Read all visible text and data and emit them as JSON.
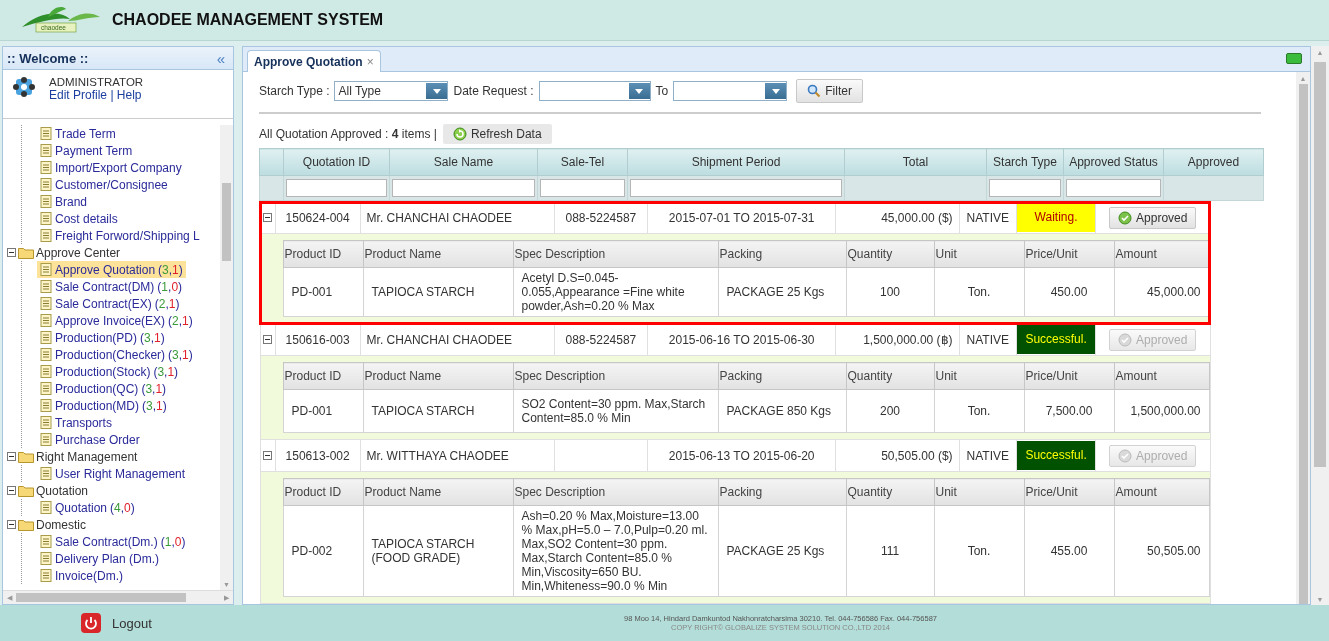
{
  "header": {
    "logo_text": "chaodee",
    "title": "CHAODEE MANAGEMENT SYSTEM"
  },
  "sidebar": {
    "title": ":: Welcome ::",
    "collapse": "«",
    "user": {
      "name": "ADMINISTRATOR",
      "links": [
        "Edit Profile",
        "Help"
      ],
      "separator": "|"
    },
    "tree": [
      {
        "expanded": true,
        "children": [
          {
            "label": "Trade Term",
            "selected": false
          },
          {
            "label": "Payment Term",
            "selected": false
          },
          {
            "label": "Import/Export Company",
            "selected": false
          },
          {
            "label": "Customer/Consignee",
            "selected": false
          },
          {
            "label": "Brand",
            "selected": false
          },
          {
            "label": "Cost details",
            "selected": false
          },
          {
            "label": "Freight Forword/Shipping L",
            "selected": false
          }
        ]
      },
      {
        "label": "Approve Center",
        "expanded": true,
        "children": [
          {
            "label": "Approve Quotation",
            "selected": true,
            "count": [
              {
                "text": "(",
                "kind": "plain"
              },
              {
                "text": "3",
                "kind": "first"
              },
              {
                "text": ",",
                "kind": "plain"
              },
              {
                "text": "1",
                "kind": "second"
              },
              {
                "text": ")",
                "kind": "plain"
              }
            ]
          },
          {
            "label": "Sale Contract(DM)",
            "selected": false,
            "count": [
              {
                "text": "(",
                "kind": "plain"
              },
              {
                "text": "1",
                "kind": "first"
              },
              {
                "text": ",",
                "kind": "plain"
              },
              {
                "text": "0",
                "kind": "second"
              },
              {
                "text": ")",
                "kind": "plain"
              }
            ]
          },
          {
            "label": "Sale Contract(EX)",
            "selected": false,
            "count": [
              {
                "text": "(",
                "kind": "plain"
              },
              {
                "text": "2",
                "kind": "first"
              },
              {
                "text": ",",
                "kind": "plain"
              },
              {
                "text": "1",
                "kind": "second"
              },
              {
                "text": ")",
                "kind": "plain"
              }
            ]
          },
          {
            "label": "Approve Invoice(EX)",
            "selected": false,
            "count": [
              {
                "text": "(",
                "kind": "plain"
              },
              {
                "text": "2",
                "kind": "first"
              },
              {
                "text": ",",
                "kind": "plain"
              },
              {
                "text": "1",
                "kind": "second"
              },
              {
                "text": ")",
                "kind": "plain"
              }
            ]
          },
          {
            "label": "Production(PD)",
            "selected": false,
            "count": [
              {
                "text": "(",
                "kind": "plain"
              },
              {
                "text": "3",
                "kind": "first"
              },
              {
                "text": ",",
                "kind": "plain"
              },
              {
                "text": "1",
                "kind": "second"
              },
              {
                "text": ")",
                "kind": "plain"
              }
            ]
          },
          {
            "label": "Production(Checker)",
            "selected": false,
            "count": [
              {
                "text": "(",
                "kind": "plain"
              },
              {
                "text": "3",
                "kind": "first"
              },
              {
                "text": ",",
                "kind": "plain"
              },
              {
                "text": "1",
                "kind": "second"
              },
              {
                "text": ")",
                "kind": "plain"
              }
            ]
          },
          {
            "label": "Production(Stock)",
            "selected": false,
            "count": [
              {
                "text": "(",
                "kind": "plain"
              },
              {
                "text": "3",
                "kind": "first"
              },
              {
                "text": ",",
                "kind": "plain"
              },
              {
                "text": "1",
                "kind": "second"
              },
              {
                "text": ")",
                "kind": "plain"
              }
            ]
          },
          {
            "label": "Production(QC)",
            "selected": false,
            "count": [
              {
                "text": "(",
                "kind": "plain"
              },
              {
                "text": "3",
                "kind": "first"
              },
              {
                "text": ",",
                "kind": "plain"
              },
              {
                "text": "1",
                "kind": "second"
              },
              {
                "text": ")",
                "kind": "plain"
              }
            ]
          },
          {
            "label": "Production(MD)",
            "selected": false,
            "count": [
              {
                "text": "(",
                "kind": "plain"
              },
              {
                "text": "3",
                "kind": "first"
              },
              {
                "text": ",",
                "kind": "plain"
              },
              {
                "text": "1",
                "kind": "second"
              },
              {
                "text": ")",
                "kind": "plain"
              }
            ]
          },
          {
            "label": "Transports",
            "selected": false
          },
          {
            "label": "Purchase Order",
            "selected": false
          }
        ]
      },
      {
        "label": "Right Management",
        "expanded": true,
        "children": [
          {
            "label": "User Right Management",
            "selected": false
          }
        ]
      },
      {
        "label": "Quotation",
        "expanded": true,
        "children": [
          {
            "label": "Quotation",
            "selected": false,
            "count": [
              {
                "text": "(",
                "kind": "plain"
              },
              {
                "text": "4",
                "kind": "first"
              },
              {
                "text": ",",
                "kind": "plain"
              },
              {
                "text": "0",
                "kind": "second"
              },
              {
                "text": ")",
                "kind": "plain"
              }
            ]
          }
        ]
      },
      {
        "label": "Domestic",
        "expanded": true,
        "children": [
          {
            "label": "Sale Contract(Dm.)",
            "selected": false,
            "count": [
              {
                "text": "(",
                "kind": "plain"
              },
              {
                "text": "1",
                "kind": "first"
              },
              {
                "text": ",",
                "kind": "plain"
              },
              {
                "text": "0",
                "kind": "second"
              },
              {
                "text": ")",
                "kind": "plain"
              }
            ]
          },
          {
            "label": "Delivery Plan (Dm.)",
            "selected": false
          },
          {
            "label": "Invoice(Dm.)",
            "selected": false
          }
        ]
      }
    ],
    "logout": "Logout"
  },
  "scroll_arrows": {
    "up": "▲",
    "down": "▼",
    "left": "◀",
    "right": "▶"
  },
  "tabs": [
    {
      "label": "Approve Quotation",
      "close": "×",
      "selected": true
    }
  ],
  "filters": {
    "starch_type": {
      "label": "Starch Type :",
      "value": "All Type"
    },
    "date_request": {
      "label": "Date Request :"
    },
    "to": {
      "label": "To"
    },
    "filter_button": "Filter"
  },
  "summary": {
    "text": "All Quotation Approved : **4** items |",
    "refresh_button": "Refresh Data"
  },
  "table": {
    "columns": [
      {
        "label": "Quotation ID",
        "filter": true
      },
      {
        "label": "Sale Name",
        "filter": true
      },
      {
        "label": "Sale-Tel",
        "filter": true
      },
      {
        "label": "Shipment Period",
        "filter": true
      },
      {
        "label": "Total",
        "filter": false
      },
      {
        "label": "Starch Type",
        "filter": true
      },
      {
        "label": "Approved Status",
        "filter": true
      },
      {
        "label": "Approved",
        "filter": false
      }
    ],
    "rows": [
      {
        "expanded": true,
        "highlighted": true,
        "quotation_id": "150624-004",
        "sale_name": "Mr. CHANCHAI CHAODEE",
        "sale_tel": "088-5224587",
        "shipment_period": "2015-07-01 TO 2015-07-31",
        "total": "45,000.00 ($)",
        "starch_type": "NATIVE",
        "status": {
          "text": "Waiting.",
          "kind": "waiting"
        },
        "approve_button": {
          "label": "Approved",
          "disabled": false
        },
        "detail_columns": [
          "Product ID",
          "Product Name",
          "Spec Description",
          "Packing",
          "Quantity",
          "Unit",
          "Price/Unit",
          "Amount"
        ],
        "details": [
          [
            "PD-001",
            "TAPIOCA STARCH",
            "Acetyl D.S=0.045-0.055,Appearance =Fine white powder,Ash=0.20 % Max",
            "PACKAGE 25 Kgs",
            "100",
            "Ton.",
            "450.00",
            "45,000.00"
          ]
        ]
      },
      {
        "expanded": true,
        "highlighted": false,
        "quotation_id": "150616-003",
        "sale_name": "Mr. CHANCHAI CHAODEE",
        "sale_tel": "088-5224587",
        "shipment_period": "2015-06-16 TO 2015-06-30",
        "total": "1,500,000.00 (฿)",
        "starch_type": "NATIVE",
        "status": {
          "text": "Successful.",
          "kind": "successful"
        },
        "approve_button": {
          "label": "Approved",
          "disabled": true
        },
        "detail_columns": [
          "Product ID",
          "Product Name",
          "Spec Description",
          "Packing",
          "Quantity",
          "Unit",
          "Price/Unit",
          "Amount"
        ],
        "details": [
          [
            "PD-001",
            "TAPIOCA STARCH",
            "SO2 Content=30 ppm. Max,Starch Content=85.0 % Min",
            "PACKAGE 850 Kgs",
            "200",
            "Ton.",
            "7,500.00",
            "1,500,000.00"
          ]
        ]
      },
      {
        "expanded": true,
        "highlighted": false,
        "quotation_id": "150613-002",
        "sale_name": "Mr. WITTHAYA CHAODEE",
        "shipment_period": "2015-06-13 TO 2015-06-20",
        "total": "50,505.00 ($)",
        "starch_type": "NATIVE",
        "status": {
          "text": "Successful.",
          "kind": "successful"
        },
        "approve_button": {
          "label": "Approved",
          "disabled": true
        },
        "detail_columns": [
          "Product ID",
          "Product Name",
          "Spec Description",
          "Packing",
          "Quantity",
          "Unit",
          "Price/Unit",
          "Amount"
        ],
        "details": [
          [
            "PD-002",
            "TAPIOCA STARCH (FOOD GRADE)",
            "Ash=0.20 % Max,Moisture=13.00 % Max,pH=5.0 – 7.0,Pulp=0.20 ml. Max,SO2 Content=30 ppm. Max,Starch Content=85.0 % Min,Viscosity=650 BU. Min,Whiteness=90.0 % Min",
            "PACKAGE 25 Kgs",
            "111",
            "Ton.",
            "455.00",
            "50,505.00"
          ]
        ]
      }
    ]
  },
  "footer": {
    "address": "98 Moo 14, Hindard Damkuntod Nakhonratcharsima 30210. Tel. 044-756586 Fax. 044-756587",
    "copyright": "COPY RIGHT© GLOBALIZE SYSTEM SOLUTION CO.,LTD 2014"
  }
}
